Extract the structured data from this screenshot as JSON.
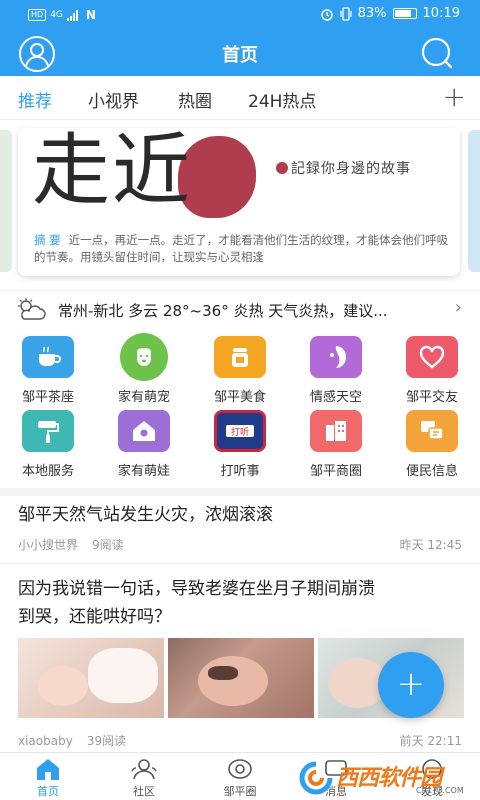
{
  "status_bar": {
    "hd": "HD",
    "network": "4G",
    "battery": "83%",
    "time": "10:19"
  },
  "header": {
    "title": "首页",
    "avatar_icon": "user-avatar-icon",
    "search_icon": "search-icon"
  },
  "tabs": [
    {
      "label": "推荐",
      "active": true
    },
    {
      "label": "小视界",
      "active": false
    },
    {
      "label": "热圈",
      "active": false
    },
    {
      "label": "24H热点",
      "active": false
    }
  ],
  "tabs_add": "+",
  "banner": {
    "calligraphy": "走近",
    "tagline": "記録你身邊的故事",
    "summary_label": "摘  要",
    "summary": "近一点，再近一点。走近了，才能看清他们生活的纹理，才能体会他们呼吸的节奏。用镜头留住时间，让现实与心灵相逢"
  },
  "weather": {
    "text": "常州-新北 多云 28°~36° 炎热 天气炎热，建议...",
    "arrow": "›"
  },
  "grid": [
    {
      "label": "邹平茶座",
      "icon": "tea-cup-icon",
      "color": "#3aa3e8"
    },
    {
      "label": "家有萌宠",
      "icon": "pet-dog-icon",
      "color": "#6cc24a"
    },
    {
      "label": "邹平美食",
      "icon": "food-jar-icon",
      "color": "#f5a623"
    },
    {
      "label": "情感天空",
      "icon": "emotion-face-icon",
      "color": "#b36ad8"
    },
    {
      "label": "邹平交友",
      "icon": "heart-icon",
      "color": "#ee5a6a"
    },
    {
      "label": "本地服务",
      "icon": "paint-roller-icon",
      "color": "#3fb7b2"
    },
    {
      "label": "家有萌娃",
      "icon": "home-baby-icon",
      "color": "#9b6fd6"
    },
    {
      "label": "打听事",
      "icon": "inquire-badge-icon",
      "color": "#c8283c"
    },
    {
      "label": "邹平商圈",
      "icon": "building-icon",
      "color": "#f06a6a"
    },
    {
      "label": "便民信息",
      "icon": "info-chat-icon",
      "color": "#f3a33a"
    }
  ],
  "articles": [
    {
      "title": "邹平天然气站发生火灾，浓烟滚滚",
      "author": "小小搜世界",
      "reads": "9阅读",
      "time": "昨天 12:45"
    },
    {
      "title_line1": "因为我说错一句话，导致老婆在坐月子期间崩溃",
      "title_line2": "到哭，还能哄好吗？",
      "author": "xiaobaby",
      "reads": "39阅读",
      "time": "前天 22:11"
    }
  ],
  "fab_label": "+",
  "bottom_nav": [
    {
      "label": "首页",
      "icon": "home-icon",
      "active": true
    },
    {
      "label": "社区",
      "icon": "community-icon",
      "active": false
    },
    {
      "label": "邹平圈",
      "icon": "circle-icon",
      "active": false
    },
    {
      "label": "消息",
      "icon": "message-icon",
      "active": false
    },
    {
      "label": "发现",
      "icon": "discover-icon",
      "active": false
    }
  ],
  "watermark": {
    "main": "西西软件园",
    "sub": "CR173.COM"
  },
  "colors": {
    "brand": "#2f9ff1",
    "seal": "#b03d4e"
  }
}
